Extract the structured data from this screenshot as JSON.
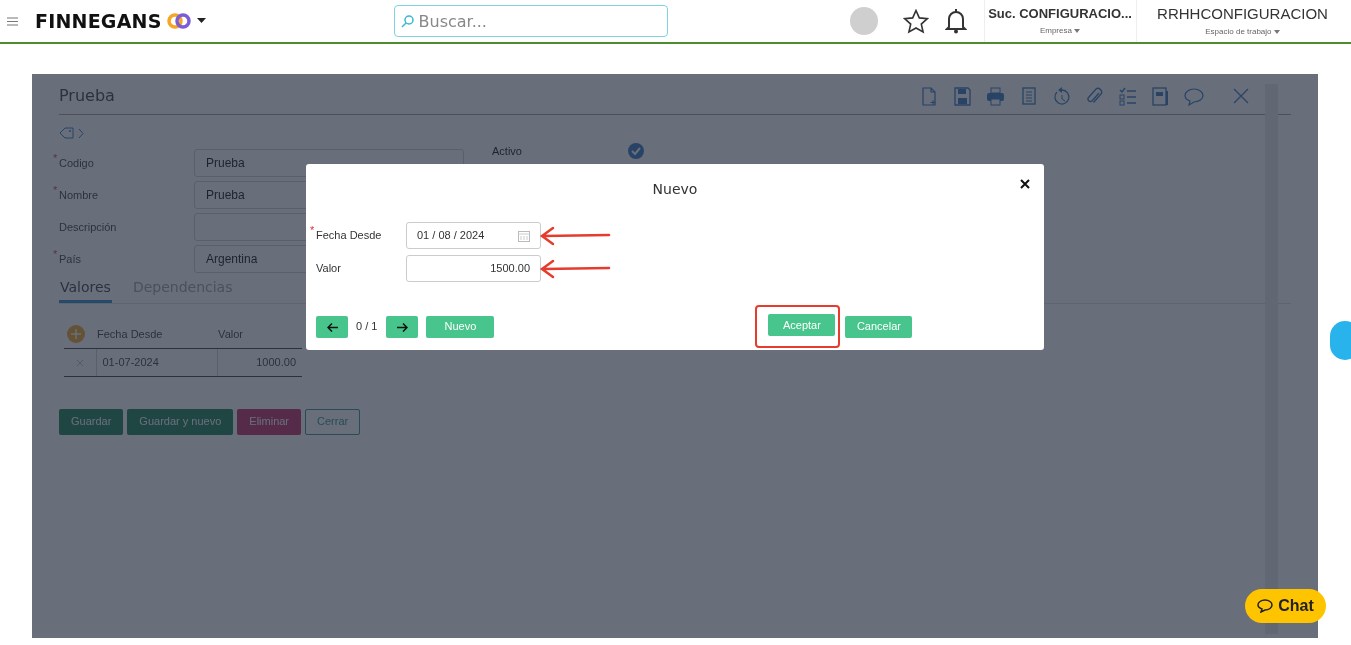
{
  "header": {
    "brand": "FINNEGANS",
    "search": {
      "placeholder": "Buscar..."
    },
    "company": {
      "value": "Suc. CONFIGURACIO...",
      "label": "Empresa"
    },
    "workspace": {
      "value": "RRHHCONFIGURACION",
      "label": "Espacio de trabajo"
    }
  },
  "form": {
    "title": "Prueba",
    "fields": [
      {
        "label": "Codigo",
        "marker": "*",
        "value": "Prueba"
      },
      {
        "label": "Nombre",
        "marker": "*",
        "value": "Prueba"
      },
      {
        "label": "Descripción"
      },
      {
        "label": "País",
        "marker": "*",
        "value": "Argentina"
      }
    ],
    "active": {
      "label": "Activo",
      "checked": true
    },
    "tabs": [
      {
        "label": "Valores",
        "selected": true
      },
      {
        "label": "Dependencias",
        "selected": false
      }
    ],
    "table": {
      "columns": [
        "Fecha Desde",
        "Valor"
      ],
      "rows": [
        [
          "01-07-2024",
          "1000.00"
        ]
      ]
    },
    "buttons": [
      {
        "label": "Guardar",
        "kind": "primary"
      },
      {
        "label": "Guardar y nuevo",
        "kind": "primary"
      },
      {
        "label": "Eliminar",
        "kind": "danger"
      },
      {
        "label": "Cerrar",
        "kind": "outline"
      }
    ]
  },
  "modal": {
    "title": "Nuevo",
    "fields": [
      {
        "label": "Fecha Desde",
        "marker": "*",
        "kind": "date",
        "value": "01 / 08 / 2024"
      },
      {
        "label": "Valor",
        "kind": "number",
        "value": "1500.00"
      }
    ],
    "pager": "0 / 1",
    "new_button": "Nuevo",
    "buttons": [
      {
        "label": "Aceptar",
        "highlighted": true
      },
      {
        "label": "Cancelar",
        "highlighted": false
      }
    ]
  },
  "chat": {
    "label": "Chat"
  }
}
